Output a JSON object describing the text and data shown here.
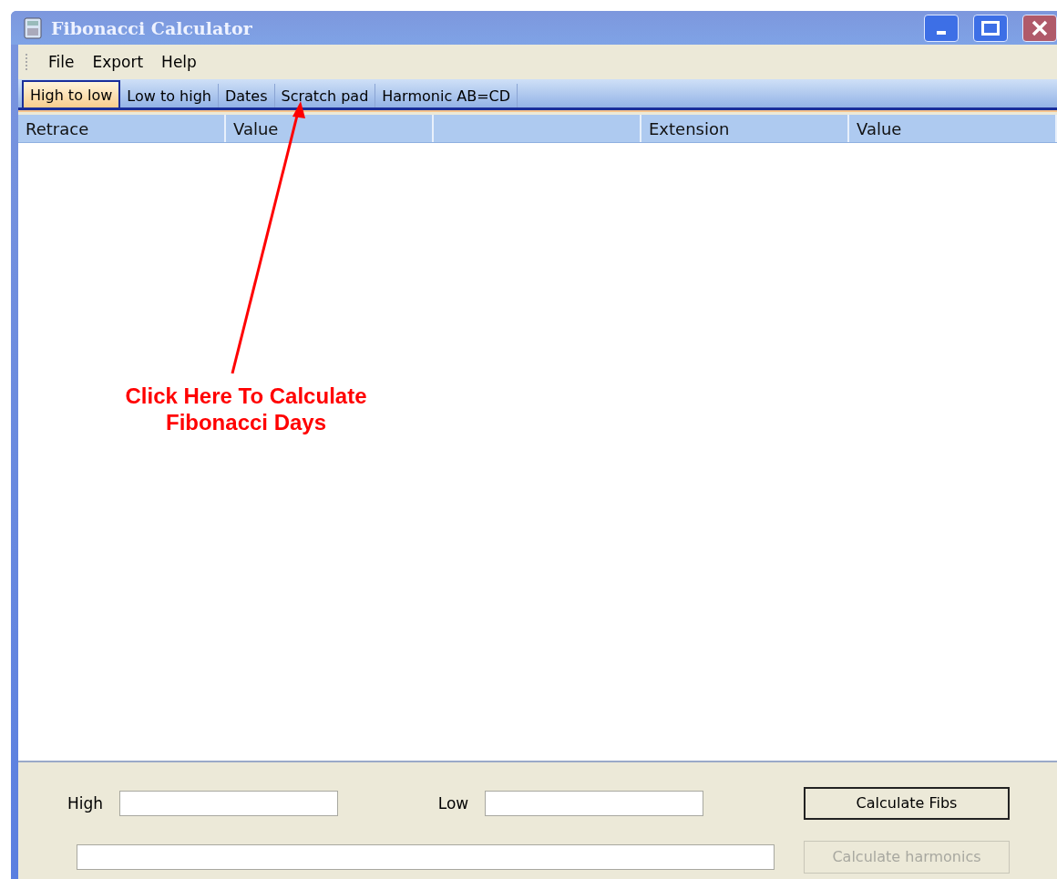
{
  "window": {
    "title": "Fibonacci Calculator"
  },
  "menu": [
    "File",
    "Export",
    "Help"
  ],
  "tabs": [
    {
      "label": "High to low",
      "selected": true
    },
    {
      "label": "Low to high",
      "selected": false
    },
    {
      "label": "Dates",
      "selected": false
    },
    {
      "label": "Scratch pad",
      "selected": false
    },
    {
      "label": "Harmonic AB=CD",
      "selected": false
    }
  ],
  "table": {
    "columns": [
      {
        "label": "Retrace"
      },
      {
        "label": "Value"
      },
      {},
      {
        "label": "Extension"
      },
      {
        "label": "Value"
      }
    ]
  },
  "form": {
    "high_label": "High",
    "low_label": "Low",
    "buttons": [
      {
        "label": "Calculate Fibs",
        "disabled": false
      },
      {
        "label": "Calculate harmonics",
        "disabled": true
      }
    ]
  },
  "annotation": {
    "lines": [
      "Click Here To Calculate",
      "Fibonacci Days"
    ]
  }
}
